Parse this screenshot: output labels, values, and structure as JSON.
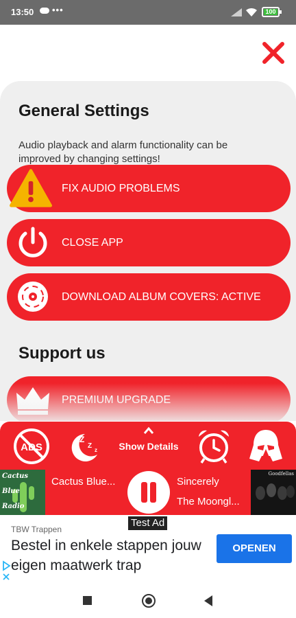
{
  "status_bar": {
    "time": "13:50",
    "dots": "•••",
    "battery": "100"
  },
  "general": {
    "title": "General Settings",
    "description": "Audio playback and alarm functionality can be improved by changing settings!",
    "buttons": [
      {
        "label": "FIX AUDIO PROBLEMS",
        "icon": "warning-icon"
      },
      {
        "label": "CLOSE APP",
        "icon": "power-icon"
      },
      {
        "label": "DOWNLOAD ALBUM COVERS: ACTIVE",
        "icon": "disc-icon"
      }
    ]
  },
  "support": {
    "title": "Support us",
    "buttons": [
      {
        "label": "PREMIUM UPGRADE",
        "icon": "crown-icon"
      }
    ]
  },
  "controls": {
    "show_details_label": "Show Details",
    "icons": [
      "no-ads-icon",
      "sleep-timer-icon",
      "chevron-up-icon",
      "alarm-clock-icon",
      "darth-vader-icon"
    ]
  },
  "player": {
    "left_station": "Cactus Blue...",
    "left_cover_text": [
      "Cactus",
      "Blue",
      "Radio"
    ],
    "right_station": "Sincerely",
    "right_track": "The Moongl...",
    "right_cover_text": "Goodfellas"
  },
  "ad": {
    "test_label": "Test Ad",
    "advertiser": "TBW Trappen",
    "headline": "Bestel in enkele stappen jouw eigen maatwerk trap",
    "cta": "OPENEN"
  },
  "colors": {
    "accent": "#f0232a",
    "card_bg": "#efefef",
    "ad_button": "#1a73e8"
  }
}
